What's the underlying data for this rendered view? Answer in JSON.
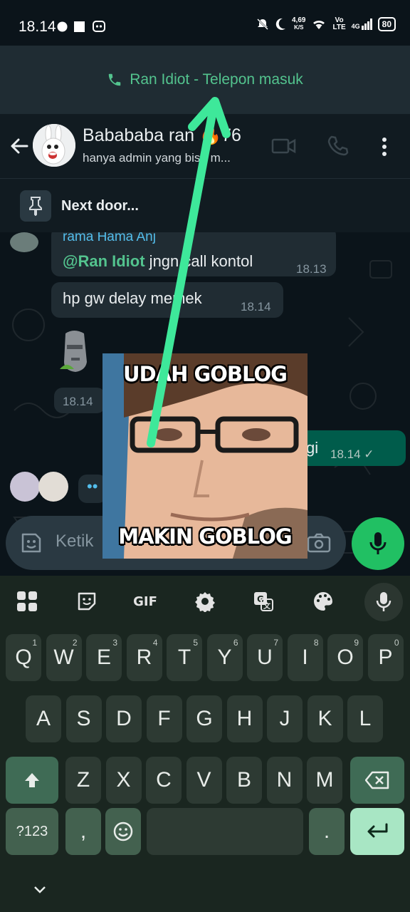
{
  "status_bar": {
    "time": "18.14",
    "net_speed_value": "4,69",
    "net_speed_unit": "K/S",
    "network_label_top": "Vo",
    "network_label_bottom": "LTE",
    "network_type": "4G",
    "battery": "80"
  },
  "call_banner": {
    "text": "Ran Idiot - Telepon masuk"
  },
  "header": {
    "title": "Babababa ran 🔥76",
    "subtitle": "hanya admin yang bisa m..."
  },
  "pinned": {
    "text": "Next door..."
  },
  "messages": [
    {
      "sender": "rama Hama Anj",
      "mention": "@Ran Idiot",
      "text": " jngn call kontol",
      "time": "18.13"
    },
    {
      "text": "hp gw delay memek",
      "time": "18.14"
    },
    {
      "time": "18.14"
    },
    {
      "text": "gi",
      "time": "18.14 ✓"
    }
  ],
  "typing_indicator": "••",
  "sticker": {
    "top_text": "UDAH GOBLOG",
    "bottom_text": "MAKIN GOBLOG"
  },
  "composer": {
    "placeholder": "Ketik"
  },
  "keyboard": {
    "toolbar": [
      "apps-icon",
      "sticker-icon",
      "GIF",
      "settings-icon",
      "translate-icon",
      "palette-icon",
      "mic-icon"
    ],
    "gif_label": "GIF",
    "row1": [
      {
        "k": "Q",
        "n": "1"
      },
      {
        "k": "W",
        "n": "2"
      },
      {
        "k": "E",
        "n": "3"
      },
      {
        "k": "R",
        "n": "4"
      },
      {
        "k": "T",
        "n": "5"
      },
      {
        "k": "Y",
        "n": "6"
      },
      {
        "k": "U",
        "n": "7"
      },
      {
        "k": "I",
        "n": "8"
      },
      {
        "k": "O",
        "n": "9"
      },
      {
        "k": "P",
        "n": "0"
      }
    ],
    "row2": [
      "A",
      "S",
      "D",
      "F",
      "G",
      "H",
      "J",
      "K",
      "L"
    ],
    "row3": [
      "Z",
      "X",
      "C",
      "V",
      "B",
      "N",
      "M"
    ],
    "symbols_label": "?123",
    "comma_label": ",",
    "period_label": "."
  },
  "colors": {
    "accent_green": "#21c063",
    "call_green": "#53c38e",
    "annotation_arrow": "#3ee89a"
  }
}
